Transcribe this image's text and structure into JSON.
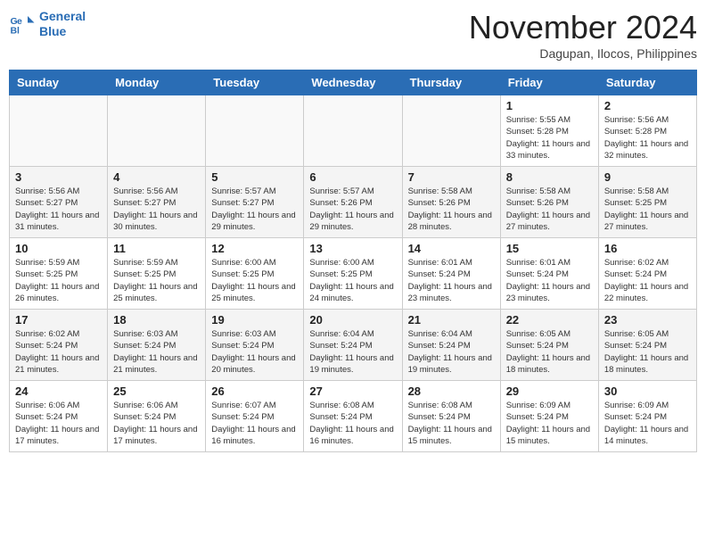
{
  "header": {
    "logo_line1": "General",
    "logo_line2": "Blue",
    "month": "November 2024",
    "location": "Dagupan, Ilocos, Philippines"
  },
  "weekdays": [
    "Sunday",
    "Monday",
    "Tuesday",
    "Wednesday",
    "Thursday",
    "Friday",
    "Saturday"
  ],
  "weeks": [
    [
      {
        "day": "",
        "info": ""
      },
      {
        "day": "",
        "info": ""
      },
      {
        "day": "",
        "info": ""
      },
      {
        "day": "",
        "info": ""
      },
      {
        "day": "",
        "info": ""
      },
      {
        "day": "1",
        "info": "Sunrise: 5:55 AM\nSunset: 5:28 PM\nDaylight: 11 hours and 33 minutes."
      },
      {
        "day": "2",
        "info": "Sunrise: 5:56 AM\nSunset: 5:28 PM\nDaylight: 11 hours and 32 minutes."
      }
    ],
    [
      {
        "day": "3",
        "info": "Sunrise: 5:56 AM\nSunset: 5:27 PM\nDaylight: 11 hours and 31 minutes."
      },
      {
        "day": "4",
        "info": "Sunrise: 5:56 AM\nSunset: 5:27 PM\nDaylight: 11 hours and 30 minutes."
      },
      {
        "day": "5",
        "info": "Sunrise: 5:57 AM\nSunset: 5:27 PM\nDaylight: 11 hours and 29 minutes."
      },
      {
        "day": "6",
        "info": "Sunrise: 5:57 AM\nSunset: 5:26 PM\nDaylight: 11 hours and 29 minutes."
      },
      {
        "day": "7",
        "info": "Sunrise: 5:58 AM\nSunset: 5:26 PM\nDaylight: 11 hours and 28 minutes."
      },
      {
        "day": "8",
        "info": "Sunrise: 5:58 AM\nSunset: 5:26 PM\nDaylight: 11 hours and 27 minutes."
      },
      {
        "day": "9",
        "info": "Sunrise: 5:58 AM\nSunset: 5:25 PM\nDaylight: 11 hours and 27 minutes."
      }
    ],
    [
      {
        "day": "10",
        "info": "Sunrise: 5:59 AM\nSunset: 5:25 PM\nDaylight: 11 hours and 26 minutes."
      },
      {
        "day": "11",
        "info": "Sunrise: 5:59 AM\nSunset: 5:25 PM\nDaylight: 11 hours and 25 minutes."
      },
      {
        "day": "12",
        "info": "Sunrise: 6:00 AM\nSunset: 5:25 PM\nDaylight: 11 hours and 25 minutes."
      },
      {
        "day": "13",
        "info": "Sunrise: 6:00 AM\nSunset: 5:25 PM\nDaylight: 11 hours and 24 minutes."
      },
      {
        "day": "14",
        "info": "Sunrise: 6:01 AM\nSunset: 5:24 PM\nDaylight: 11 hours and 23 minutes."
      },
      {
        "day": "15",
        "info": "Sunrise: 6:01 AM\nSunset: 5:24 PM\nDaylight: 11 hours and 23 minutes."
      },
      {
        "day": "16",
        "info": "Sunrise: 6:02 AM\nSunset: 5:24 PM\nDaylight: 11 hours and 22 minutes."
      }
    ],
    [
      {
        "day": "17",
        "info": "Sunrise: 6:02 AM\nSunset: 5:24 PM\nDaylight: 11 hours and 21 minutes."
      },
      {
        "day": "18",
        "info": "Sunrise: 6:03 AM\nSunset: 5:24 PM\nDaylight: 11 hours and 21 minutes."
      },
      {
        "day": "19",
        "info": "Sunrise: 6:03 AM\nSunset: 5:24 PM\nDaylight: 11 hours and 20 minutes."
      },
      {
        "day": "20",
        "info": "Sunrise: 6:04 AM\nSunset: 5:24 PM\nDaylight: 11 hours and 19 minutes."
      },
      {
        "day": "21",
        "info": "Sunrise: 6:04 AM\nSunset: 5:24 PM\nDaylight: 11 hours and 19 minutes."
      },
      {
        "day": "22",
        "info": "Sunrise: 6:05 AM\nSunset: 5:24 PM\nDaylight: 11 hours and 18 minutes."
      },
      {
        "day": "23",
        "info": "Sunrise: 6:05 AM\nSunset: 5:24 PM\nDaylight: 11 hours and 18 minutes."
      }
    ],
    [
      {
        "day": "24",
        "info": "Sunrise: 6:06 AM\nSunset: 5:24 PM\nDaylight: 11 hours and 17 minutes."
      },
      {
        "day": "25",
        "info": "Sunrise: 6:06 AM\nSunset: 5:24 PM\nDaylight: 11 hours and 17 minutes."
      },
      {
        "day": "26",
        "info": "Sunrise: 6:07 AM\nSunset: 5:24 PM\nDaylight: 11 hours and 16 minutes."
      },
      {
        "day": "27",
        "info": "Sunrise: 6:08 AM\nSunset: 5:24 PM\nDaylight: 11 hours and 16 minutes."
      },
      {
        "day": "28",
        "info": "Sunrise: 6:08 AM\nSunset: 5:24 PM\nDaylight: 11 hours and 15 minutes."
      },
      {
        "day": "29",
        "info": "Sunrise: 6:09 AM\nSunset: 5:24 PM\nDaylight: 11 hours and 15 minutes."
      },
      {
        "day": "30",
        "info": "Sunrise: 6:09 AM\nSunset: 5:24 PM\nDaylight: 11 hours and 14 minutes."
      }
    ]
  ]
}
